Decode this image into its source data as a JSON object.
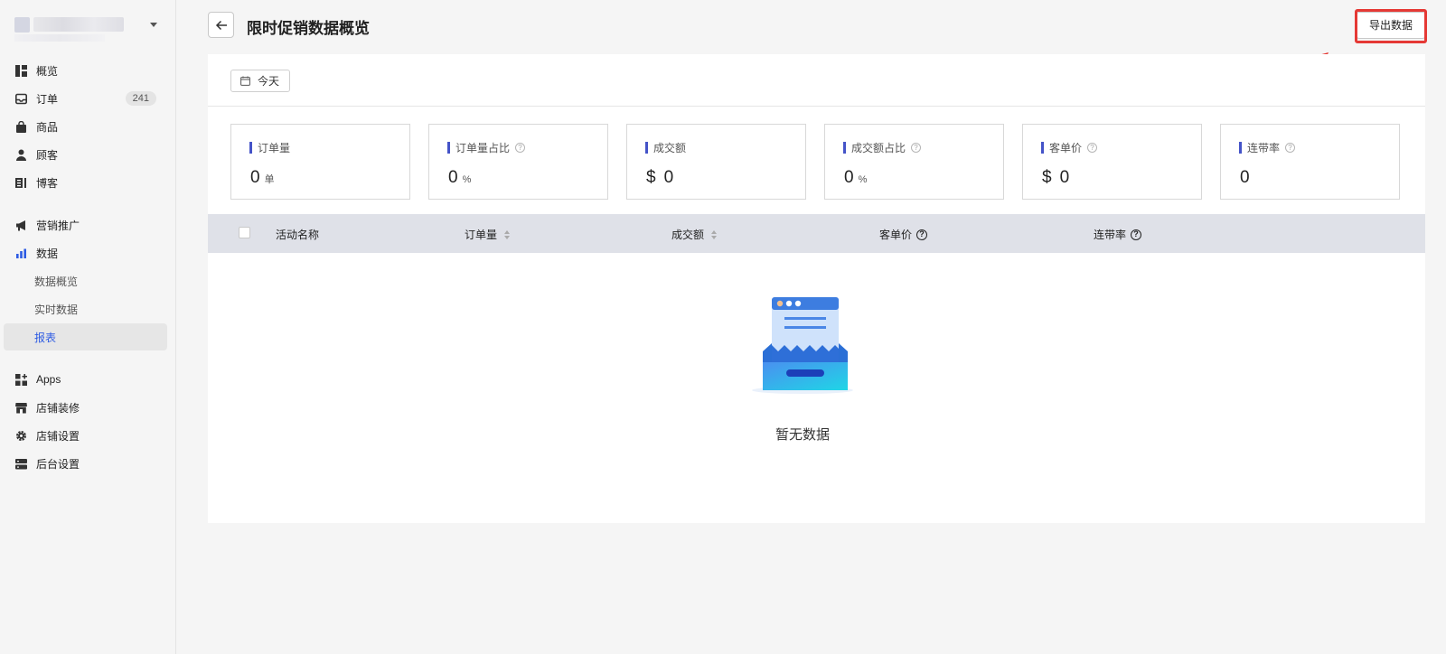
{
  "header": {
    "title": "限时促销数据概览",
    "export_label": "导出数据"
  },
  "sidebar": {
    "items": [
      {
        "label": "概览",
        "icon": "dashboard-icon"
      },
      {
        "label": "订单",
        "icon": "inbox-icon",
        "badge": "241"
      },
      {
        "label": "商品",
        "icon": "shopping-bag-icon"
      },
      {
        "label": "顾客",
        "icon": "user-icon"
      },
      {
        "label": "博客",
        "icon": "document-icon"
      },
      {
        "label": "营销推广",
        "icon": "megaphone-icon"
      },
      {
        "label": "数据",
        "icon": "bar-chart-icon"
      },
      {
        "label": "数据概览",
        "sub": true
      },
      {
        "label": "实时数据",
        "sub": true
      },
      {
        "label": "报表",
        "sub": true,
        "active": true
      },
      {
        "label": "Apps",
        "icon": "apps-icon"
      },
      {
        "label": "店铺装修",
        "icon": "storefront-icon"
      },
      {
        "label": "店铺设置",
        "icon": "gear-icon"
      },
      {
        "label": "后台设置",
        "icon": "server-icon"
      }
    ]
  },
  "filter": {
    "date_label": "今天"
  },
  "stats": [
    {
      "label": "订单量",
      "value": "0",
      "unit": "单",
      "help": false
    },
    {
      "label": "订单量占比",
      "value": "0",
      "unit": "%",
      "help": true
    },
    {
      "label": "成交额",
      "currency": "$",
      "value": "0",
      "help": false
    },
    {
      "label": "成交额占比",
      "value": "0",
      "unit": "%",
      "help": true
    },
    {
      "label": "客单价",
      "currency": "$",
      "value": "0",
      "help": true
    },
    {
      "label": "连带率",
      "value": "0",
      "help": true
    }
  ],
  "table": {
    "columns": [
      "活动名称",
      "订单量",
      "成交额",
      "客单价",
      "连带率"
    ],
    "empty_text": "暂无数据"
  },
  "colors": {
    "accent": "#2d5be3",
    "stat_bar": "#4453c8",
    "highlight": "#e53935"
  }
}
